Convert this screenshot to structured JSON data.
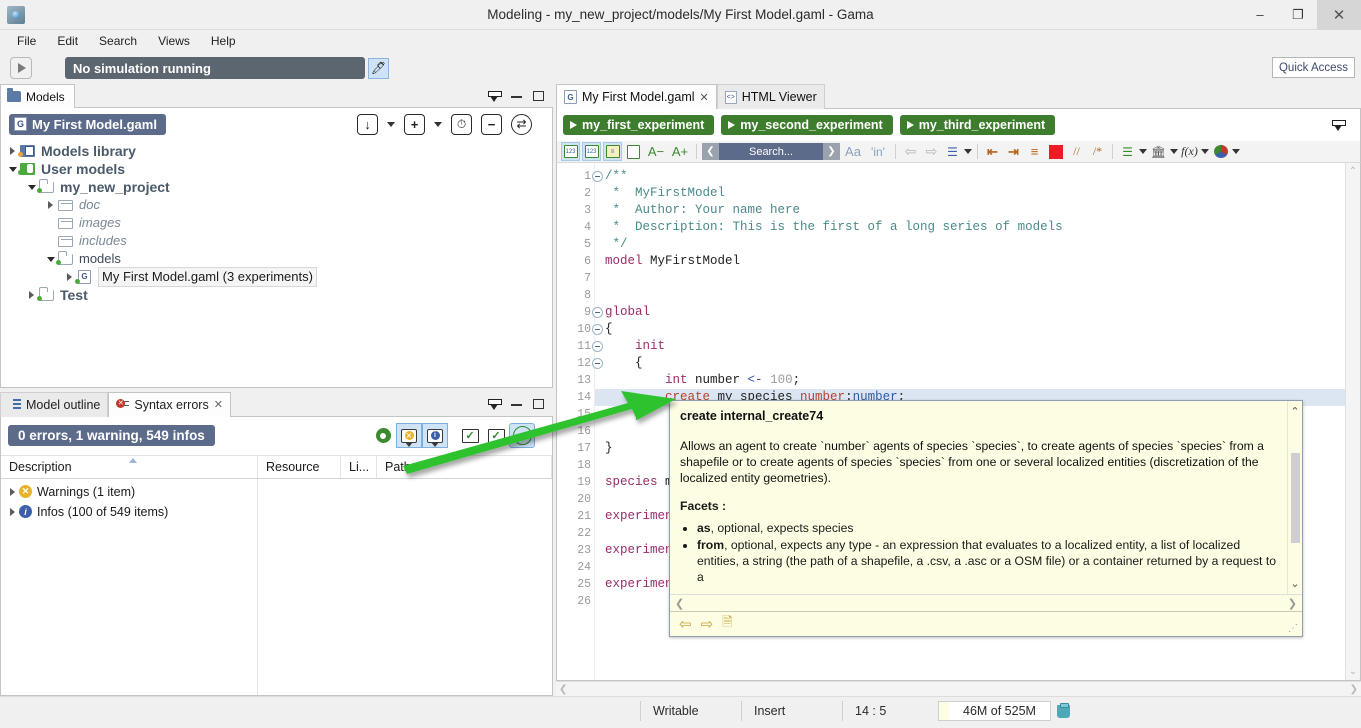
{
  "window": {
    "title": "Modeling - my_new_project/models/My First Model.gaml - Gama",
    "app_icon": "gama-logo-icon",
    "minimize": "–",
    "maximize": "❐",
    "close": "✕"
  },
  "menubar": {
    "items": [
      "File",
      "Edit",
      "Search",
      "Views",
      "Help"
    ]
  },
  "simbar": {
    "status": "No simulation running",
    "edit_icon": "pencil-icon",
    "play_icon": "play-icon",
    "quick_access": "Quick Access"
  },
  "models_view": {
    "tab_label": "Models",
    "tab_icon": "folder-icon",
    "minimize_icon": "minimize-icon",
    "maximize_icon": "maximize-icon",
    "restore_icon": "restore-icon",
    "selected_file": "My First Model.gaml",
    "selected_file_icon": "gaml-file-icon",
    "toolbar": [
      {
        "name": "import-models-icon",
        "glyph": "↓"
      },
      {
        "name": "new-model-icon",
        "glyph": "+"
      },
      {
        "name": "history-icon",
        "glyph": "⏱"
      },
      {
        "name": "collapse-all-icon",
        "glyph": "−"
      },
      {
        "name": "refresh-icon",
        "glyph": "⇄"
      }
    ],
    "tree": [
      {
        "label": "Models library",
        "indent": 0,
        "twisty": "closed",
        "icon": "library-icon",
        "style": "bold",
        "dot": "orange"
      },
      {
        "label": "User models",
        "indent": 0,
        "twisty": "open",
        "icon": "user-models-icon",
        "style": "bold",
        "dot": "green"
      },
      {
        "label": "my_new_project",
        "indent": 1,
        "twisty": "open",
        "icon": "project-folder-icon",
        "style": "bold",
        "dot": "green"
      },
      {
        "label": "doc",
        "indent": 2,
        "twisty": "closed",
        "icon": "folder-icon",
        "style": "italic",
        "dot": "none"
      },
      {
        "label": "images",
        "indent": 2,
        "twisty": "none",
        "icon": "folder-icon",
        "style": "italic",
        "dot": "none"
      },
      {
        "label": "includes",
        "indent": 2,
        "twisty": "none",
        "icon": "folder-icon",
        "style": "italic",
        "dot": "none"
      },
      {
        "label": "models",
        "indent": 2,
        "twisty": "open",
        "icon": "folder-icon",
        "style": "plain",
        "dot": "green"
      },
      {
        "label": "My First Model.gaml (3 experiments)",
        "indent": 3,
        "twisty": "closed",
        "icon": "gaml-file-icon",
        "style": "selected",
        "dot": "green"
      },
      {
        "label": "Test",
        "indent": 1,
        "twisty": "closed",
        "icon": "project-folder-icon",
        "style": "bold",
        "dot": "green"
      }
    ]
  },
  "bottom_view": {
    "tabs": [
      {
        "label": "Model outline",
        "icon": "outline-icon",
        "active": false
      },
      {
        "label": "Syntax errors",
        "icon": "syntax-errors-icon",
        "active": true,
        "close": "✕"
      }
    ],
    "summary": "0 errors, 1 warning, 549 infos",
    "toolbar": [
      {
        "name": "settings-gear-icon",
        "active": false
      },
      {
        "name": "show-warnings-icon",
        "active": true
      },
      {
        "name": "show-infos-icon",
        "active": true
      },
      {
        "name": "scope-all-icon",
        "active": false
      },
      {
        "name": "scope-selected-icon",
        "active": false
      },
      {
        "name": "scope-any-icon",
        "active": true
      }
    ],
    "columns": [
      "Description",
      "Resource",
      "Li...",
      "Path"
    ],
    "rows": [
      {
        "description": "Warnings (1 item)",
        "icon": "warning-icon",
        "resource": "",
        "line": "",
        "path": ""
      },
      {
        "description": "Infos (100 of 549 items)",
        "icon": "info-icon",
        "resource": "",
        "line": "",
        "path": ""
      }
    ]
  },
  "editor": {
    "tabs": [
      {
        "label": "My First Model.gaml",
        "icon": "gaml-file-icon",
        "active": true,
        "close": "✕"
      },
      {
        "label": "HTML Viewer",
        "icon": "html-viewer-icon",
        "active": false
      }
    ],
    "view_menu_icon": "view-menu-icon",
    "experiments": [
      {
        "label": "my_first_experiment"
      },
      {
        "label": "my_second_experiment"
      },
      {
        "label": "my_third_experiment"
      }
    ],
    "toolbar": {
      "search_placeholder": "Search...",
      "prev_glyph": "❮",
      "next_glyph": "❯",
      "case_glyph": "Aa",
      "word_glyph": "'in'",
      "font_smaller": "A−",
      "font_larger": "A+",
      "comment_line": "//",
      "comment_block": "/*",
      "items": [
        "toggle-line-numbers-icon",
        "toggle-markers-icon",
        "toggle-overview-icon",
        "word-wrap-icon",
        "decrease-font-icon",
        "increase-font-icon",
        "find-previous-icon",
        "search-input",
        "find-next-icon",
        "match-case-icon",
        "whole-word-icon",
        "navigate-back-icon",
        "navigate-forward-icon",
        "outline-list-icon",
        "shift-left-icon",
        "shift-right-icon",
        "format-icon",
        "color-picker-icon",
        "line-comment-icon",
        "block-comment-icon",
        "insert-template-icon",
        "insert-builtin-icon",
        "insert-operator-icon",
        "insert-color-icon"
      ]
    },
    "lines": [
      {
        "n": 1,
        "fold": true,
        "tokens": [
          {
            "t": "/**",
            "c": "cm"
          }
        ]
      },
      {
        "n": 2,
        "fold": false,
        "tokens": [
          {
            "t": " *  MyFirstModel",
            "c": "cm"
          }
        ]
      },
      {
        "n": 3,
        "fold": false,
        "tokens": [
          {
            "t": " *  Author: Your name here",
            "c": "cm"
          }
        ]
      },
      {
        "n": 4,
        "fold": false,
        "tokens": [
          {
            "t": " *  Description: This is the first of a long series of models",
            "c": "cm"
          }
        ]
      },
      {
        "n": 5,
        "fold": false,
        "tokens": [
          {
            "t": " */",
            "c": "cm"
          }
        ]
      },
      {
        "n": 6,
        "fold": false,
        "tokens": [
          {
            "t": "model",
            "c": "kw"
          },
          {
            "t": " MyFirstModel",
            "c": "id"
          }
        ]
      },
      {
        "n": 7,
        "fold": false,
        "tokens": []
      },
      {
        "n": 8,
        "fold": false,
        "tokens": []
      },
      {
        "n": 9,
        "fold": true,
        "tokens": [
          {
            "t": "global",
            "c": "kw"
          }
        ]
      },
      {
        "n": 10,
        "fold": true,
        "tokens": [
          {
            "t": "{",
            "c": "id"
          }
        ]
      },
      {
        "n": 11,
        "fold": true,
        "tokens": [
          {
            "t": "    init",
            "c": "kw"
          }
        ]
      },
      {
        "n": 12,
        "fold": true,
        "tokens": [
          {
            "t": "    {",
            "c": "id"
          }
        ]
      },
      {
        "n": 13,
        "fold": false,
        "tokens": [
          {
            "t": "        ",
            "c": "id"
          },
          {
            "t": "int",
            "c": "kw"
          },
          {
            "t": " number ",
            "c": "id"
          },
          {
            "t": "<-",
            "c": "op"
          },
          {
            "t": " ",
            "c": "id"
          },
          {
            "t": "100",
            "c": "num"
          },
          {
            "t": ";",
            "c": "id"
          }
        ]
      },
      {
        "n": 14,
        "fold": false,
        "highlight": true,
        "tokens": [
          {
            "t": "        ",
            "c": "id"
          },
          {
            "t": "create",
            "c": "fn"
          },
          {
            "t": " my_species ",
            "c": "id"
          },
          {
            "t": "number",
            "c": "fn"
          },
          {
            "t": ":",
            "c": "id"
          },
          {
            "t": "number",
            "c": "vr"
          },
          {
            "t": ";",
            "c": "id"
          }
        ]
      },
      {
        "n": 15,
        "fold": false,
        "tokens": [
          {
            "t": "    }",
            "c": "id"
          }
        ]
      },
      {
        "n": 16,
        "fold": false,
        "tokens": []
      },
      {
        "n": 17,
        "fold": false,
        "tokens": [
          {
            "t": "}",
            "c": "id"
          }
        ]
      },
      {
        "n": 18,
        "fold": false,
        "tokens": []
      },
      {
        "n": 19,
        "fold": false,
        "tokens": [
          {
            "t": "species",
            "c": "kw"
          },
          {
            "t": " my",
            "c": "id"
          }
        ]
      },
      {
        "n": 20,
        "fold": false,
        "tokens": []
      },
      {
        "n": 21,
        "fold": false,
        "tokens": [
          {
            "t": "experiment",
            "c": "kw"
          }
        ]
      },
      {
        "n": 22,
        "fold": false,
        "tokens": []
      },
      {
        "n": 23,
        "fold": false,
        "tokens": [
          {
            "t": "experiment",
            "c": "kw"
          }
        ]
      },
      {
        "n": 24,
        "fold": false,
        "tokens": []
      },
      {
        "n": 25,
        "fold": false,
        "tokens": [
          {
            "t": "experiment",
            "c": "kw"
          }
        ]
      },
      {
        "n": 26,
        "fold": false,
        "tokens": []
      }
    ]
  },
  "tooltip": {
    "title": "create internal_create74",
    "description": "Allows an agent to create `number` agents of species `species`, to create agents of species `species` from a shapefile or to create agents of species `species` from one or several localized entities (discretization of the localized entity geometries).",
    "facets_label": "Facets :",
    "facets": [
      {
        "name": "as",
        "text": ", optional, expects species"
      },
      {
        "name": "from",
        "text": ", optional, expects any type - an expression that evaluates to a localized entity, a list of localized entities, a string (the path of a shapefile, a .csv, a .asc or a OSM file) or a container returned by a request to a"
      }
    ],
    "footer_icons": [
      "nav-back-icon",
      "nav-forward-icon",
      "open-doc-icon"
    ],
    "scroll_up": "⌃",
    "scroll_down": "⌄",
    "scroll_left": "❮",
    "scroll_right": "❯"
  },
  "statusbar": {
    "writable": "Writable",
    "insert_mode": "Insert",
    "cursor_position": "14 : 5",
    "memory": "46M of 525M",
    "trash_icon": "trash-icon"
  },
  "colors": {
    "accent_blue": "#5c6b8a",
    "experiment_green": "#3f7d2e",
    "arrow_green": "#2fc22f",
    "tooltip_bg": "#fdfde3",
    "error_red": "#c0392b",
    "warning_yellow": "#e8b22d",
    "info_blue": "#3b5fa8"
  }
}
